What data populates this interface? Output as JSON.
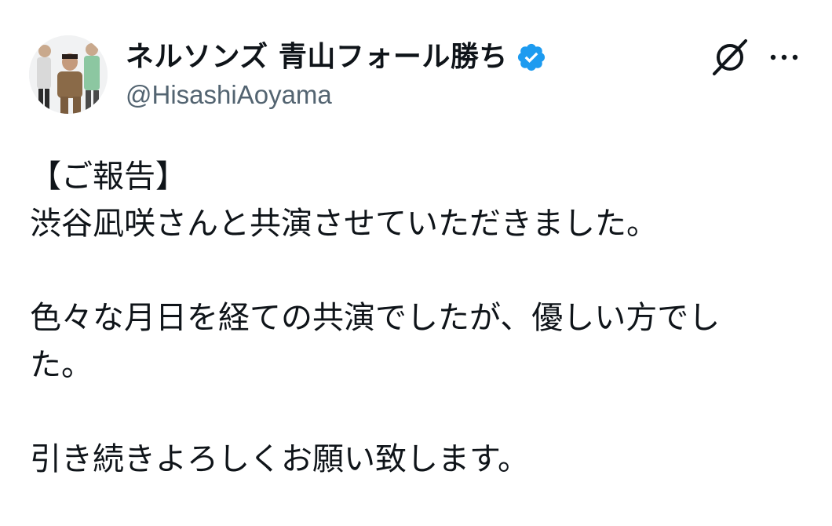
{
  "author": {
    "display_name": "ネルソンズ 青山フォール勝ち",
    "handle": "@HisashiAoyama",
    "verified": true,
    "verified_color": "#1d9bf0"
  },
  "header_actions": {
    "grok_icon": "grok-icon",
    "more_icon": "more-icon"
  },
  "tweet": {
    "lines": [
      "【ご報告】",
      "渋谷凪咲さんと共演させていただきました。",
      "",
      "色々な月日を経ての共演でしたが、優しい方でし",
      "た。",
      "",
      "引き続きよろしくお願い致します。"
    ]
  },
  "colors": {
    "text": "#0f1419",
    "secondary_text": "#536471",
    "accent": "#1d9bf0"
  }
}
